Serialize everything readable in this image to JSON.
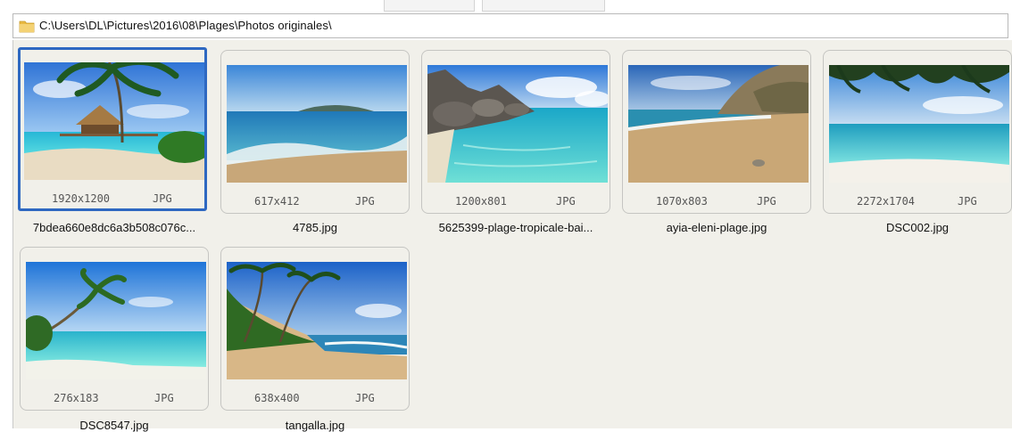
{
  "address_bar": {
    "path": "C:\\Users\\DL\\Pictures\\2016\\08\\Plages\\Photos originales\\",
    "icon": "folder-icon"
  },
  "thumbnails": [
    {
      "filename": "7bdea660e8dc6a3b508c076c...",
      "dimensions": "1920x1200",
      "type": "JPG",
      "selected": true,
      "scene": "palm hut on turquoise lagoon"
    },
    {
      "filename": "4785.jpg",
      "dimensions": "617x412",
      "type": "JPG",
      "selected": false,
      "scene": "waves on beach with distant island"
    },
    {
      "filename": "5625399-plage-tropicale-bai...",
      "dimensions": "1200x801",
      "type": "JPG",
      "selected": false,
      "scene": "granite boulders and clear water"
    },
    {
      "filename": "ayia-eleni-plage.jpg",
      "dimensions": "1070x803",
      "type": "JPG",
      "selected": false,
      "scene": "sandy cove with cliff"
    },
    {
      "filename": "DSC002.jpg",
      "dimensions": "2272x1704",
      "type": "JPG",
      "selected": false,
      "scene": "palm fronds over turquoise sea"
    },
    {
      "filename": "DSC8547.jpg",
      "dimensions": "276x183",
      "type": "JPG",
      "selected": false,
      "scene": "leaning palm tree over lagoon"
    },
    {
      "filename": "tangalla.jpg",
      "dimensions": "638x400",
      "type": "JPG",
      "selected": false,
      "scene": "palm-lined beach with waves"
    }
  ],
  "colors": {
    "selection_border": "#2e68c1",
    "panel_background": "#f1f0ea",
    "folder_yellow": "#f2c75c"
  }
}
